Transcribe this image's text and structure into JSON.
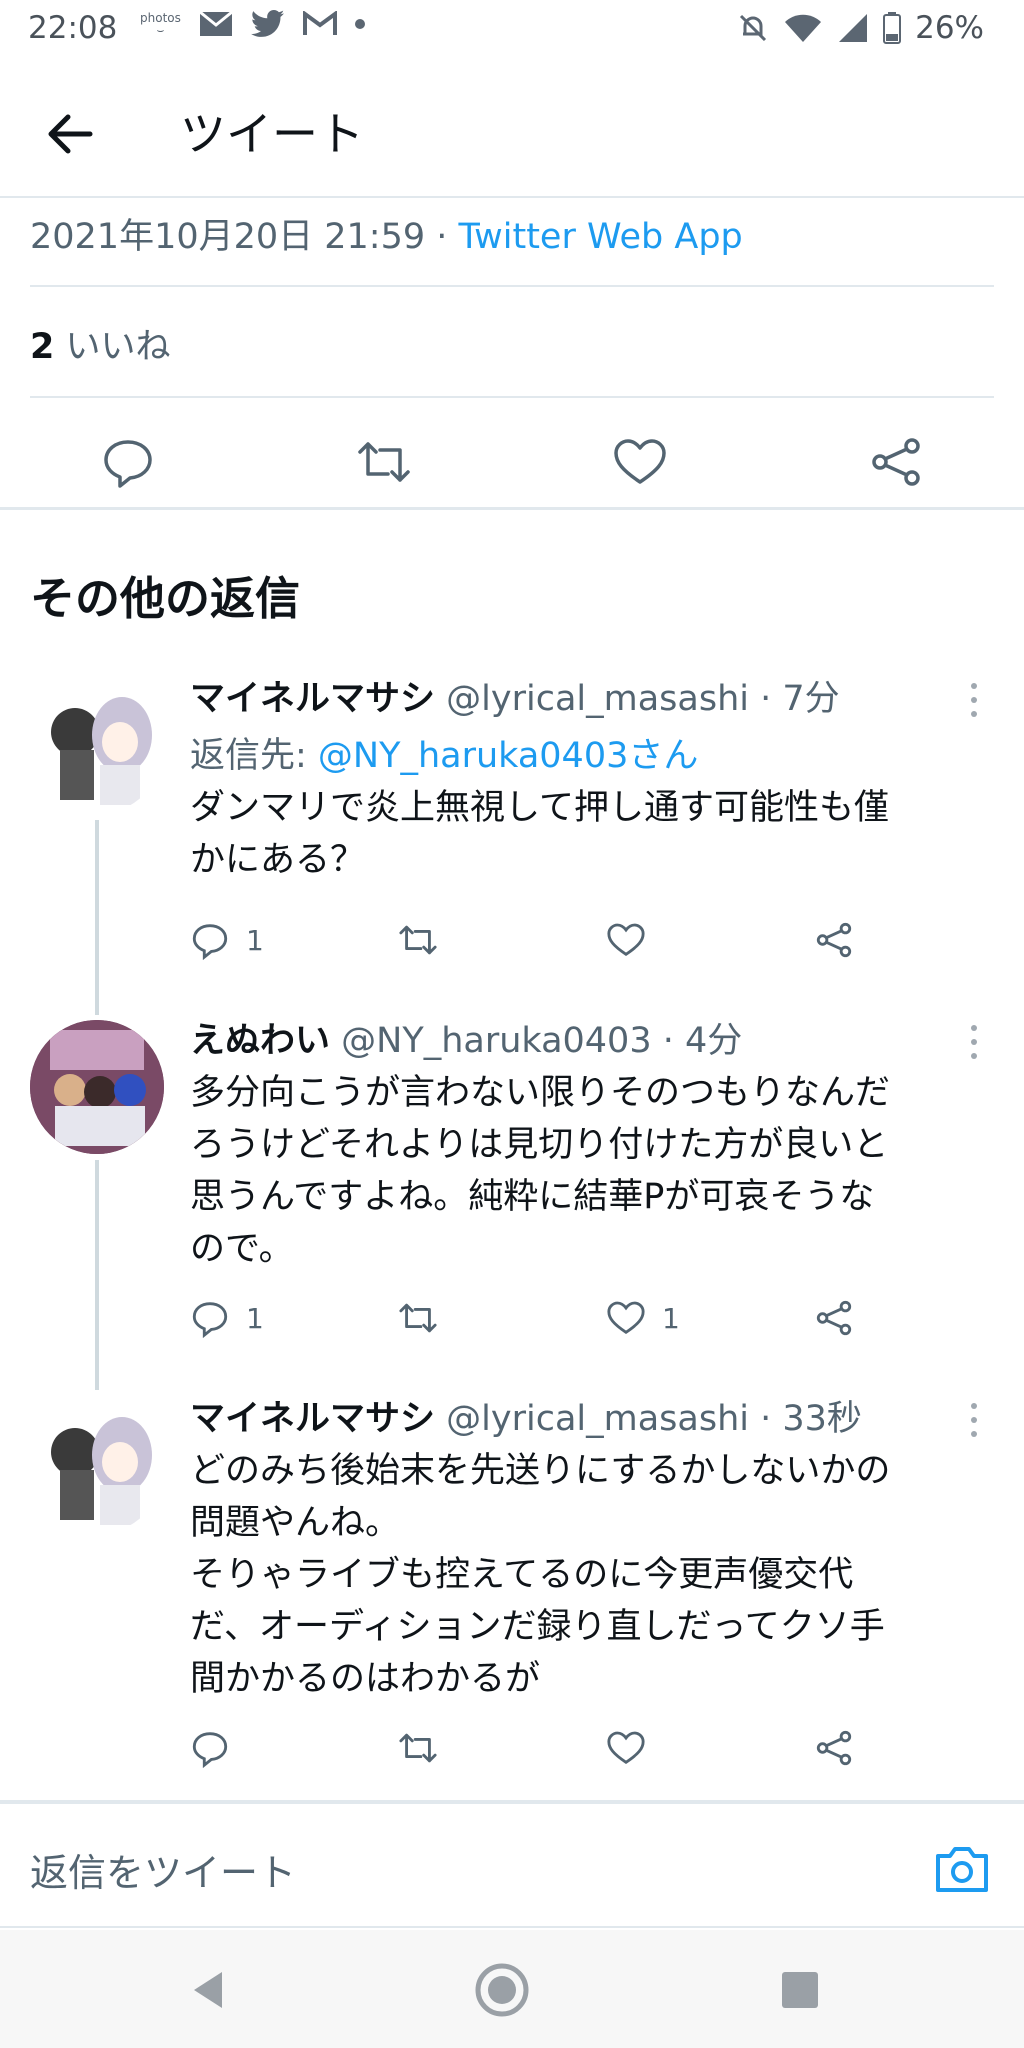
{
  "status_bar": {
    "time": "22:08",
    "battery": "26%",
    "photos_label": "photos"
  },
  "header": {
    "title": "ツイート"
  },
  "tweet_meta": {
    "datetime": "2021年10月20日 21:59",
    "separator": " · ",
    "source": "Twitter Web App",
    "likes_count": "2",
    "likes_label": " いいね"
  },
  "section": {
    "title": "その他の返信"
  },
  "replies": [
    {
      "name": "マイネルマサシ",
      "handle": "@lyrical_masashi",
      "time": " · 7分",
      "reply_to_label": "返信先: ",
      "reply_to_mention": "@NY_haruka0403さん",
      "text": "ダンマリで炎上無視して押し通す可能性も僅\nかにある？",
      "reply_count": "1",
      "retweet_count": "",
      "like_count": ""
    },
    {
      "name": "えぬわい",
      "handle": "@NY_haruka0403",
      "time": " · 4分",
      "text": "多分向こうが言わない限りそのつもりなんだ\nろうけどそれよりは見切り付けた方が良いと\n思うんですよね。純粋に結華Pが可哀そうな\nので。",
      "reply_count": "1",
      "retweet_count": "",
      "like_count": "1"
    },
    {
      "name": "マイネルマサシ",
      "handle": "@lyrical_masashi",
      "time": " · 33秒",
      "text": "どのみち後始末を先送りにするかしないかの\n問題やんね。\nそりゃライブも控えてるのに今更声優交代\nだ、オーディションだ録り直しだってクソ手\n間かかるのはわかるが",
      "reply_count": "",
      "retweet_count": "",
      "like_count": ""
    }
  ],
  "compose": {
    "placeholder": "返信をツイート"
  },
  "colors": {
    "accent": "#1d9bf0",
    "text": "#0f1419",
    "muted": "#536471",
    "divider": "#e1e8ed"
  }
}
